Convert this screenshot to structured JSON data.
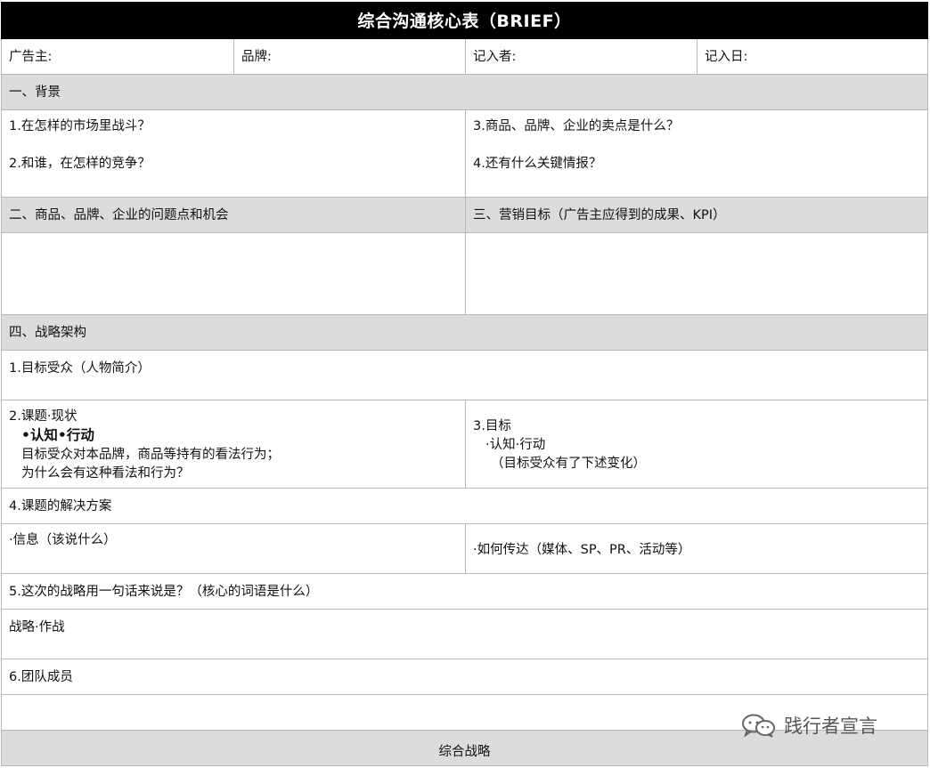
{
  "title": "综合沟通核心表（BRIEF）",
  "header": {
    "advertiser": "广告主:",
    "brand": "品牌:",
    "recorder": "记入者:",
    "record_date": "记入日:"
  },
  "section1": {
    "heading": "一、背景",
    "q1": "1.在怎样的市场里战斗？",
    "q2": "2.和谁，在怎样的竞争？",
    "q3": "3.商品、品牌、企业的卖点是什么？",
    "q4": "4.还有什么关键情报？"
  },
  "section2": {
    "heading": "二、商品、品牌、企业的问题点和机会"
  },
  "section3": {
    "heading": "三、营销目标（广告主应得到的成果、KPI）"
  },
  "section4": {
    "heading": "四、战略架构",
    "target_audience": "1.目标受众（人物简介）",
    "issue_title": "2.课题·现状",
    "issue_sub": "•认知•行动",
    "issue_line1": "目标受众对本品牌，商品等持有的看法行为；",
    "issue_line2": "为什么会有这种看法和行为？",
    "goal_title": "3.目标",
    "goal_sub": "·认知·行动",
    "goal_note": "（目标受众有了下述变化）",
    "solution": "4.课题的解决方案",
    "message": "·信息（该说什么）",
    "delivery": "·如何传达（媒体、SP、PR、活动等）",
    "one_phrase": "5.这次的战略用一句话来说是？（核心的词语是什么）",
    "tactics": "战略·作战",
    "team": "6.团队成员"
  },
  "footer": {
    "label": "综合战略"
  },
  "watermark": {
    "text": "践行者宣言",
    "icon": "wechat-icon"
  }
}
